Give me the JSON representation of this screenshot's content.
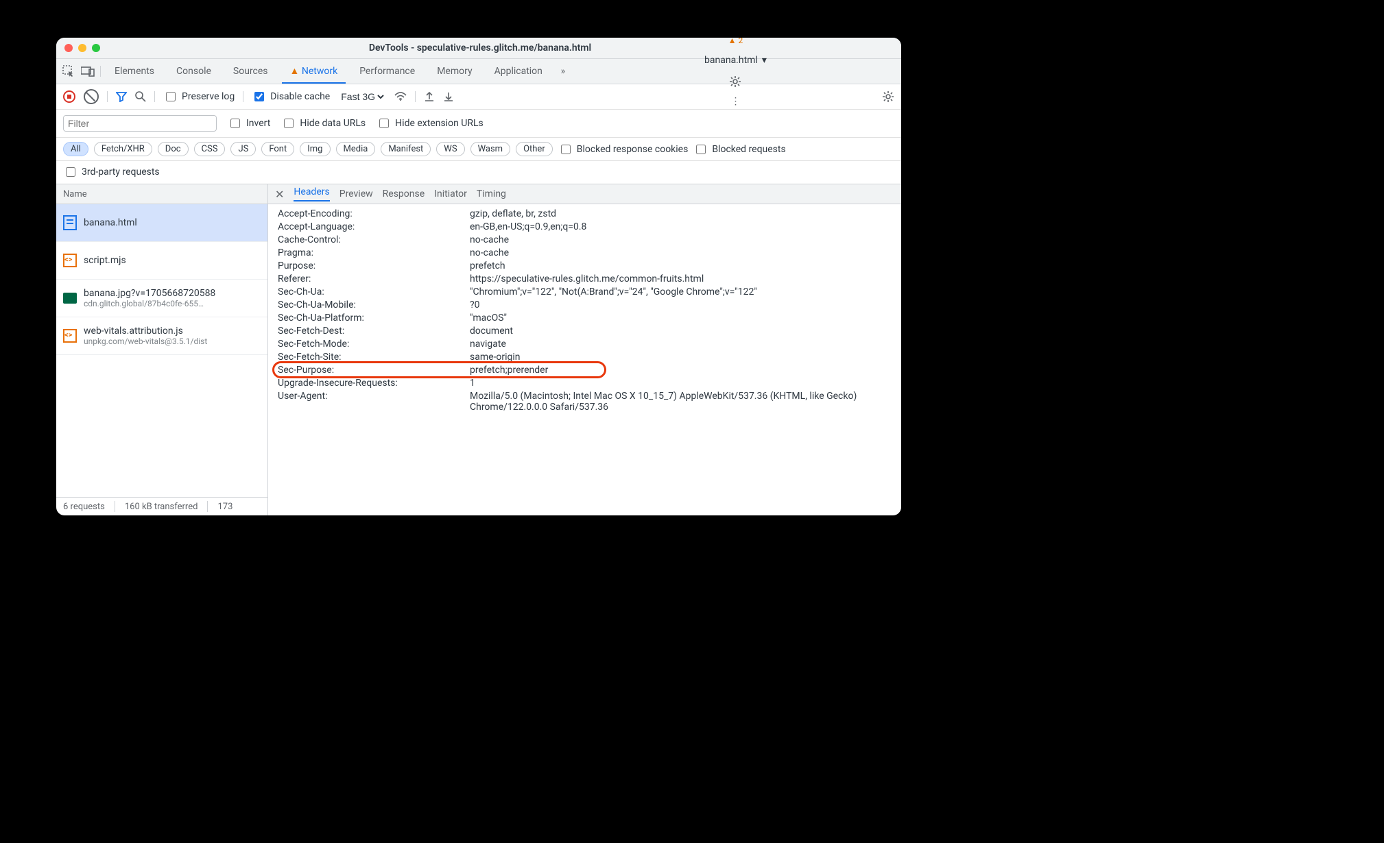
{
  "window": {
    "title": "DevTools - speculative-rules.glitch.me/banana.html"
  },
  "tabs": {
    "items": [
      "Elements",
      "Console",
      "Sources",
      "Network",
      "Performance",
      "Memory",
      "Application"
    ],
    "active": 3,
    "warn_count": "2",
    "context": "banana.html"
  },
  "toolbar": {
    "preserve_log": "Preserve log",
    "disable_cache": "Disable cache",
    "throttling": "Fast 3G"
  },
  "filter": {
    "placeholder": "Filter",
    "invert": "Invert",
    "hide_data": "Hide data URLs",
    "hide_ext": "Hide extension URLs"
  },
  "types": [
    "All",
    "Fetch/XHR",
    "Doc",
    "CSS",
    "JS",
    "Font",
    "Img",
    "Media",
    "Manifest",
    "WS",
    "Wasm",
    "Other"
  ],
  "type_checks": {
    "blocked_cookies": "Blocked response cookies",
    "blocked_req": "Blocked requests",
    "third_party": "3rd-party requests"
  },
  "requests": {
    "col": "Name",
    "items": [
      {
        "icon": "doc",
        "name": "banana.html",
        "sub": "",
        "selected": true
      },
      {
        "icon": "js",
        "name": "script.mjs",
        "sub": ""
      },
      {
        "icon": "img",
        "name": "banana.jpg?v=1705668720588",
        "sub": "cdn.glitch.global/87b4c0fe-655…"
      },
      {
        "icon": "js",
        "name": "web-vitals.attribution.js",
        "sub": "unpkg.com/web-vitals@3.5.1/dist"
      }
    ]
  },
  "detail": {
    "tabs": [
      "Headers",
      "Preview",
      "Response",
      "Initiator",
      "Timing"
    ],
    "active": 0,
    "headers": [
      {
        "k": "Accept-Encoding:",
        "v": "gzip, deflate, br, zstd"
      },
      {
        "k": "Accept-Language:",
        "v": "en-GB,en-US;q=0.9,en;q=0.8"
      },
      {
        "k": "Cache-Control:",
        "v": "no-cache"
      },
      {
        "k": "Pragma:",
        "v": "no-cache"
      },
      {
        "k": "Purpose:",
        "v": "prefetch"
      },
      {
        "k": "Referer:",
        "v": "https://speculative-rules.glitch.me/common-fruits.html"
      },
      {
        "k": "Sec-Ch-Ua:",
        "v": "\"Chromium\";v=\"122\", \"Not(A:Brand\";v=\"24\", \"Google Chrome\";v=\"122\""
      },
      {
        "k": "Sec-Ch-Ua-Mobile:",
        "v": "?0"
      },
      {
        "k": "Sec-Ch-Ua-Platform:",
        "v": "\"macOS\""
      },
      {
        "k": "Sec-Fetch-Dest:",
        "v": "document"
      },
      {
        "k": "Sec-Fetch-Mode:",
        "v": "navigate"
      },
      {
        "k": "Sec-Fetch-Site:",
        "v": "same-origin"
      },
      {
        "k": "Sec-Purpose:",
        "v": "prefetch;prerender",
        "hi": true
      },
      {
        "k": "Upgrade-Insecure-Requests:",
        "v": "1"
      },
      {
        "k": "User-Agent:",
        "v": "Mozilla/5.0 (Macintosh; Intel Mac OS X 10_15_7) AppleWebKit/537.36 (KHTML, like Gecko) Chrome/122.0.0.0 Safari/537.36"
      }
    ]
  },
  "status": {
    "requests": "6 requests",
    "transferred": "160 kB transferred",
    "resources": "173"
  }
}
